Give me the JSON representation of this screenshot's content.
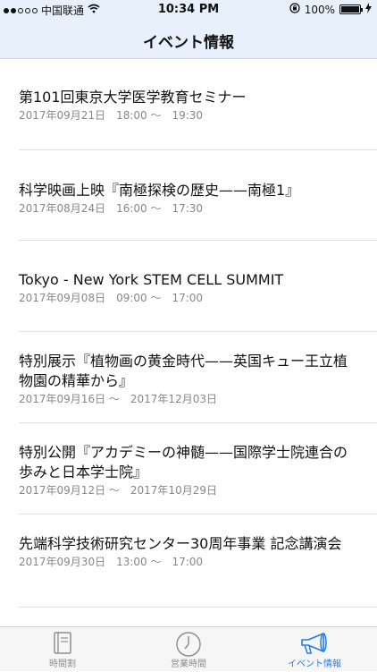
{
  "status_bar": {
    "carrier": "中国联通",
    "time": "10:34 PM",
    "battery": "100%"
  },
  "nav": {
    "title": "イベント情報"
  },
  "events": [
    {
      "title": "第101回東京大学医学教育セミナー",
      "date": "2017年09月21日　18:00 ～　19:30"
    },
    {
      "title": "科学映画上映『南極探検の歴史——南極1』",
      "date": "2017年08月24日　16:00 ～　17:30"
    },
    {
      "title": "Tokyo - New York STEM CELL SUMMIT",
      "date": "2017年09月08日　09:00 ～　17:00"
    },
    {
      "title": "特別展示『植物画の黄金時代——英国キュー王立植物園の精華から』",
      "date": "2017年09月16日 ～　2017年12月03日"
    },
    {
      "title": "特別公開『アカデミーの神髄——国際学士院連合の歩みと日本学士院』",
      "date": "2017年09月12日 ～　2017年10月29日"
    },
    {
      "title": "先端科学技術研究センター30周年事業 記念講演会",
      "date": "2017年09月30日　13:00 ～　17:00"
    }
  ],
  "tabs": [
    {
      "label": "時間割",
      "icon": "book-icon",
      "active": false
    },
    {
      "label": "営業時間",
      "icon": "clock-icon",
      "active": false
    },
    {
      "label": "イベント情報",
      "icon": "megaphone-icon",
      "active": true
    }
  ],
  "colors": {
    "accent": "#1e7df0",
    "bar_background": "#e8f1fb",
    "secondary_text": "#888888"
  }
}
